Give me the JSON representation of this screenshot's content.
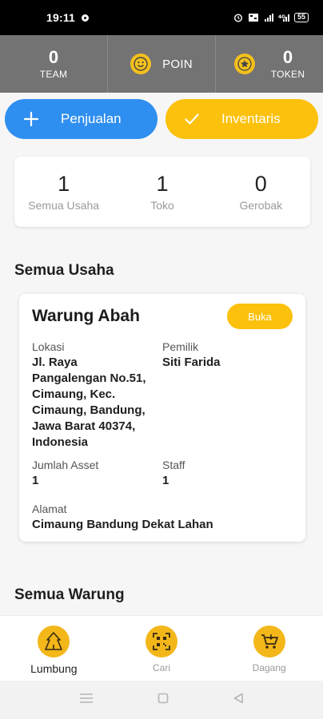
{
  "status_bar": {
    "time": "19:11",
    "battery": "55"
  },
  "top_stats": {
    "team": {
      "value": "0",
      "label": "TEAM"
    },
    "poin": {
      "label": "POIN"
    },
    "token": {
      "value": "0",
      "label": "TOKEN"
    }
  },
  "actions": {
    "penjualan": "Penjualan",
    "inventaris": "Inventaris"
  },
  "summary": [
    {
      "value": "1",
      "label": "Semua Usaha"
    },
    {
      "value": "1",
      "label": "Toko"
    },
    {
      "value": "0",
      "label": "Gerobak"
    }
  ],
  "section_semua_usaha": "Semua Usaha",
  "business": {
    "name": "Warung Abah",
    "status": "Buka",
    "lokasi_label": "Lokasi",
    "lokasi_lines": [
      "Jl. Raya",
      "Pangalengan No.51,",
      "Cimaung, Kec.",
      "Cimaung, Bandung,",
      "Jawa Barat 40374,",
      "Indonesia"
    ],
    "pemilik_label": "Pemilik",
    "pemilik": "Siti Farida",
    "jumlah_asset_label": "Jumlah Asset",
    "jumlah_asset": "1",
    "staff_label": "Staff",
    "staff": "1",
    "alamat_label": "Alamat",
    "alamat": "Cimaung Bandung Dekat Lahan"
  },
  "section_semua_warung": "Semua Warung",
  "bottom_nav": [
    {
      "label": "Lumbung",
      "icon": "lumbung-icon",
      "active": true
    },
    {
      "label": "Cari",
      "icon": "qr-scan-icon",
      "active": false
    },
    {
      "label": "Dagang",
      "icon": "cart-icon",
      "active": false
    }
  ],
  "colors": {
    "blue": "#2f8ff0",
    "yellow": "#fbc10c",
    "header_gray": "#737373"
  }
}
